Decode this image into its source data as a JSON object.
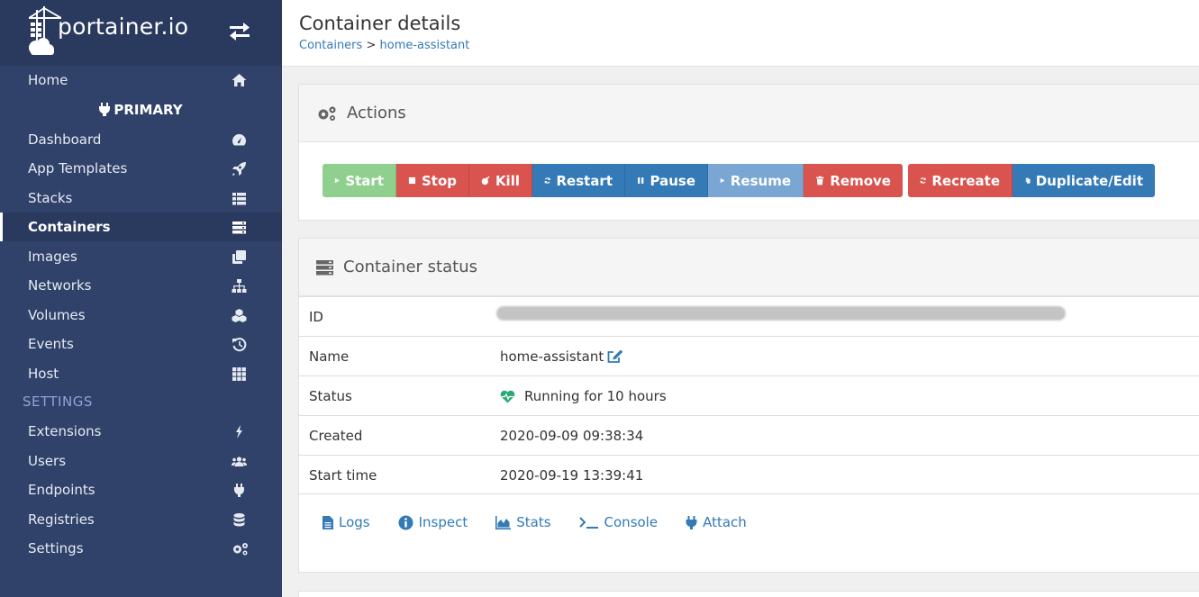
{
  "brand": {
    "name": "portainer.io"
  },
  "sidebar": {
    "home": "Home",
    "endpoint": "PRIMARY",
    "items": [
      {
        "label": "Dashboard",
        "icon": "tachometer-icon"
      },
      {
        "label": "App Templates",
        "icon": "rocket-icon"
      },
      {
        "label": "Stacks",
        "icon": "list-icon"
      },
      {
        "label": "Containers",
        "icon": "server-icon"
      },
      {
        "label": "Images",
        "icon": "clone-icon"
      },
      {
        "label": "Networks",
        "icon": "sitemap-icon"
      },
      {
        "label": "Volumes",
        "icon": "cubes-icon"
      },
      {
        "label": "Events",
        "icon": "history-icon"
      },
      {
        "label": "Host",
        "icon": "th-icon"
      }
    ],
    "settings_header": "SETTINGS",
    "settings": [
      {
        "label": "Extensions",
        "icon": "bolt-icon"
      },
      {
        "label": "Users",
        "icon": "users-icon"
      },
      {
        "label": "Endpoints",
        "icon": "plug-icon"
      },
      {
        "label": "Registries",
        "icon": "database-icon"
      },
      {
        "label": "Settings",
        "icon": "cogs-icon"
      }
    ]
  },
  "header": {
    "title": "Container details",
    "breadcrumb_link": "Containers",
    "breadcrumb_sep": ">",
    "breadcrumb_current": "home-assistant"
  },
  "actions": {
    "title": "Actions",
    "start": "Start",
    "stop": "Stop",
    "kill": "Kill",
    "restart": "Restart",
    "pause": "Pause",
    "resume": "Resume",
    "remove": "Remove",
    "recreate": "Recreate",
    "duplicate": "Duplicate/Edit"
  },
  "status": {
    "title": "Container status",
    "rows": {
      "id_label": "ID",
      "name_label": "Name",
      "name_value": "home-assistant",
      "status_label": "Status",
      "status_value": "Running for 10 hours",
      "created_label": "Created",
      "created_value": "2020-09-09 09:38:34",
      "start_label": "Start time",
      "start_value": "2020-09-19 13:39:41"
    },
    "links": {
      "logs": "Logs",
      "inspect": "Inspect",
      "stats": "Stats",
      "console": "Console",
      "attach": "Attach"
    }
  },
  "colors": {
    "sidebar": "#30426a",
    "accent": "#337ab7",
    "danger": "#d9534f",
    "success": "#8fd08f"
  }
}
